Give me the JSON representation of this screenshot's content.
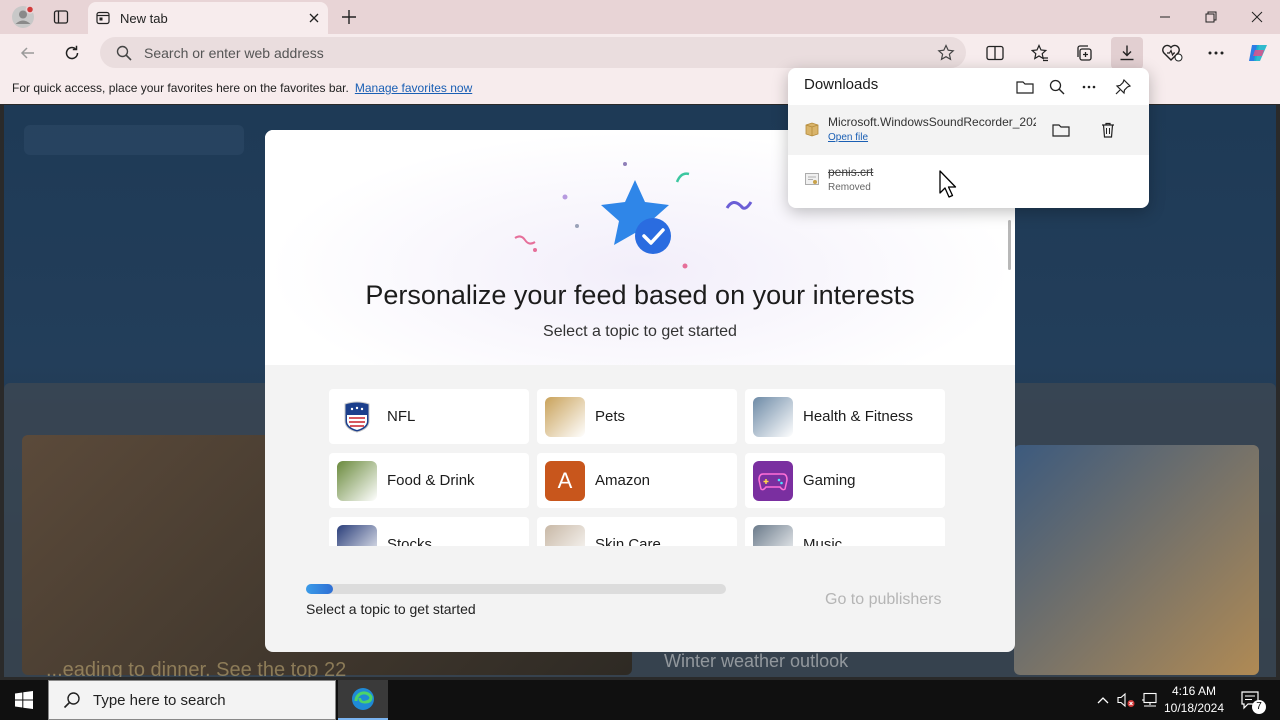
{
  "browser": {
    "tab_title": "New tab",
    "address_placeholder": "Search or enter web address",
    "favorites_bar_text": "For quick access, place your favorites here on the favorites bar.",
    "favorites_bar_link": "Manage favorites now"
  },
  "downloads": {
    "title": "Downloads",
    "items": [
      {
        "filename": "Microsoft.WindowsSoundRecorder_202",
        "action": "Open file"
      },
      {
        "filename": "penis.crt",
        "status": "Removed"
      }
    ]
  },
  "modal": {
    "title": "Personalize your feed based on your interests",
    "subtitle": "Select a topic to get started",
    "topics": [
      {
        "label": "NFL",
        "icon": "nfl-shield-icon",
        "color": "#1c3f8c"
      },
      {
        "label": "Pets",
        "icon": "pets-photo-icon",
        "color": "#c9a25a"
      },
      {
        "label": "Health & Fitness",
        "icon": "fitness-photo-icon",
        "color": "#6d8aa6"
      },
      {
        "label": "Food & Drink",
        "icon": "food-photo-icon",
        "color": "#6a8a3c"
      },
      {
        "label": "Amazon",
        "icon": "amazon-letter-icon",
        "letter": "A",
        "color": "#c8561c"
      },
      {
        "label": "Gaming",
        "icon": "gamepad-icon",
        "color": "#7a2fa0"
      },
      {
        "label": "Stocks",
        "icon": "stocks-photo-icon",
        "color": "#2a3e7a"
      },
      {
        "label": "Skin Care",
        "icon": "skincare-photo-icon",
        "color": "#c8b8a6"
      },
      {
        "label": "Music",
        "icon": "music-photo-icon",
        "color": "#6a7a8a"
      }
    ],
    "progress_fraction": 0.065,
    "progress_label": "Select a topic to get started",
    "publishers_button": "Go to publishers"
  },
  "background": {
    "headline_left": "...eading to dinner. See the top 22",
    "headline_right": "Winter weather outlook"
  },
  "taskbar": {
    "search_placeholder": "Type here to search",
    "time": "4:16 AM",
    "date": "10/18/2024",
    "notification_count": "7"
  }
}
